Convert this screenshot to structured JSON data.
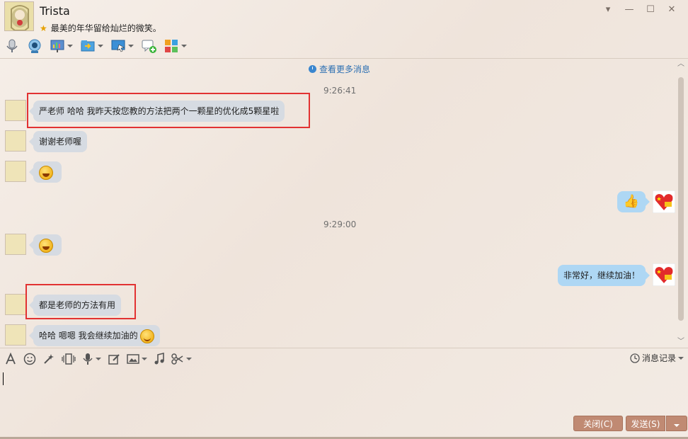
{
  "header": {
    "contact_name": "Trista",
    "signature": "最美的年华留给灿烂的微笑。"
  },
  "chat": {
    "view_more": "查看更多消息",
    "timestamps": [
      "9:26:41",
      "9:29:00"
    ],
    "messages": [
      {
        "from": "contact",
        "text": "严老师 哈哈 我昨天按您教的方法把两个一颗星的优化成5颗星啦",
        "highlighted": true
      },
      {
        "from": "contact",
        "text": "谢谢老师喔",
        "highlighted": false
      },
      {
        "from": "contact",
        "emoji": "grin-emoji"
      },
      {
        "from": "me",
        "emoji": "thumbs-up-emoji"
      },
      {
        "from": "contact",
        "emoji": "grin-emoji"
      },
      {
        "from": "me",
        "text": "非常好，继续加油！"
      },
      {
        "from": "contact",
        "text": "都是老师的方法有用",
        "highlighted": true
      },
      {
        "from": "contact",
        "text": "哈哈 嗯嗯 我会继续加油的",
        "emoji": "smile-emoji",
        "highlighted": false
      }
    ]
  },
  "input": {
    "history_label": "消息记录"
  },
  "buttons": {
    "close": "关闭(C)",
    "send": "发送(S)"
  },
  "colors": {
    "incoming_bubble": "#d6dbe2",
    "outgoing_bubble": "#aed7f4",
    "highlight_box": "#e23232",
    "button": "#c08a73",
    "link": "#2c6fb2"
  }
}
